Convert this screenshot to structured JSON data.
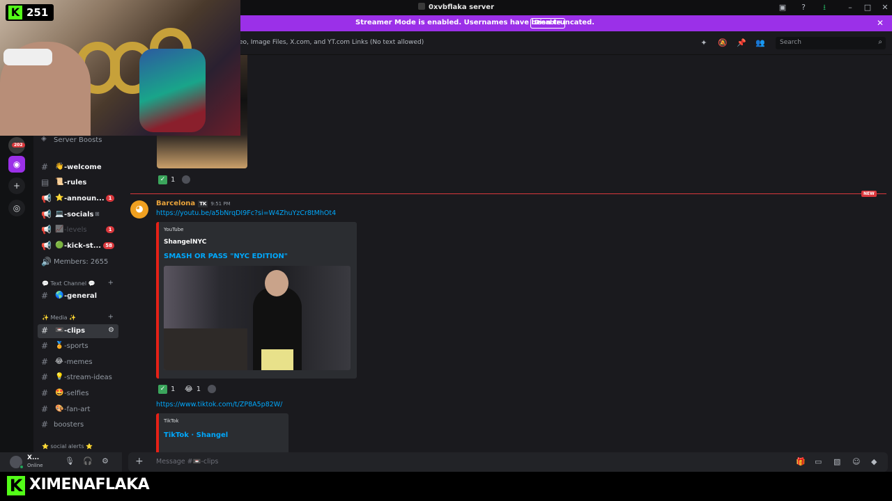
{
  "titlebar": {
    "title": "0xvbflaka server"
  },
  "banner": {
    "text": "Streamer Mode is enabled. Usernames have been truncated.",
    "disable_label": "Disable"
  },
  "header": {
    "topic": "eo, Image Files, X.com, and YT.com Links (No text allowed)",
    "search_placeholder": "Search"
  },
  "webcam": {
    "kick_count": "251"
  },
  "rail": {
    "badge": "202"
  },
  "sidebar": {
    "server_boosts": "Server Boosts",
    "channels": [
      {
        "emoji": "👋",
        "label": "-welcome"
      },
      {
        "emoji": "📜",
        "label": "-rules"
      },
      {
        "emoji": "⭐",
        "label": "-announ...",
        "badge": "1"
      },
      {
        "emoji": "💻",
        "label": "-socials",
        "suffix": "⊞"
      },
      {
        "emoji": "📈",
        "label": "-levels",
        "badge": "1"
      },
      {
        "emoji": "🟢",
        "label": "-kick-st...",
        "badge": "58"
      },
      {
        "emoji": "",
        "label": "Members: 2655"
      }
    ],
    "cat_text": "💬 Text Channel 💬",
    "general": {
      "emoji": "🌎",
      "label": "-general"
    },
    "cat_media": "✨ Media ✨",
    "media_channels": [
      {
        "emoji": "📼",
        "label": "-clips"
      },
      {
        "emoji": "🏅",
        "label": "-sports"
      },
      {
        "emoji": "😂",
        "label": "-memes"
      },
      {
        "emoji": "💡",
        "label": "-stream-ideas"
      },
      {
        "emoji": "🤩",
        "label": "-selfies"
      },
      {
        "emoji": "🎨",
        "label": "-fan-art"
      },
      {
        "emoji": "",
        "label": "boosters"
      }
    ],
    "cat_social": "⭐ social alerts ⭐"
  },
  "user": {
    "name": "X...",
    "status": "Online"
  },
  "chat": {
    "react1_count": "1",
    "new_tag": "NEW",
    "author": "Barcelona",
    "author_tag": "TK",
    "time": "9:51 PM",
    "link1": "https://youtu.be/a5bNrqDI9Fc?si=W4ZhuYzCr8tMhOt4",
    "embed1": {
      "provider": "YouTube",
      "author": "ShangelNYC",
      "title": "SMASH OR PASS \"NYC EDITION\""
    },
    "react2_check": "1",
    "react2_laugh": "1",
    "link2": "https://www.tiktok.com/t/ZP8A5p82W/",
    "embed2": {
      "provider": "TikTok",
      "title": "TikTok · Shangel"
    }
  },
  "composer": {
    "placeholder": "Message #📼-clips"
  },
  "stream": {
    "channel_name": "XIMENAFLAKA"
  },
  "colors": {
    "accent": "#9b30e8",
    "kick": "#53fc18",
    "link": "#00a8fc",
    "danger": "#da373c"
  }
}
